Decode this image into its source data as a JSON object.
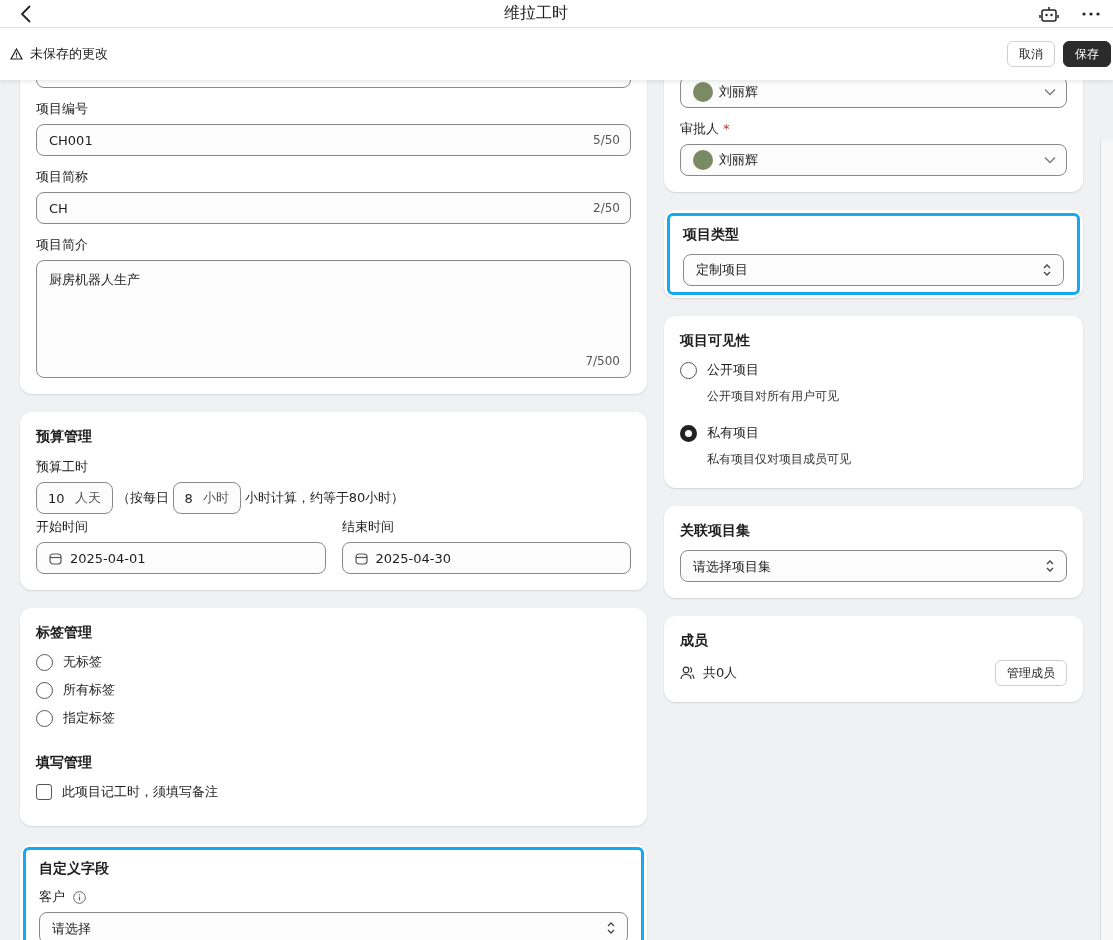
{
  "topbar": {
    "title": "维拉工时"
  },
  "notice": {
    "text": "未保存的更改"
  },
  "actions": [
    {
      "label": "取消",
      "kind": "secondary"
    },
    {
      "label": "保存",
      "kind": "primary"
    }
  ],
  "basic_info": {
    "fields": [
      {
        "kind": "input"
      },
      {
        "kind": "input",
        "label": "项目编号",
        "value": "CH001",
        "count": "5/50"
      },
      {
        "kind": "input",
        "label": "项目简称",
        "value": "CH",
        "count": "2/50"
      },
      {
        "kind": "textarea",
        "label": "项目简介",
        "value": "厨房机器人生产",
        "count": "7/500"
      }
    ]
  },
  "budget": {
    "title": "预算管理",
    "hours_label": "预算工时",
    "days_value": "10",
    "days_unit": "人天",
    "text_before": "（按每日",
    "hours_value": "8",
    "hours_unit": "小时",
    "text_after": "小时计算，约等于80小时）",
    "start_label": "开始时间",
    "start_value": "2025-04-01",
    "end_label": "结束时间",
    "end_value": "2025-04-30"
  },
  "tags": {
    "title": "标签管理",
    "options": [
      {
        "label": "无标签",
        "selected": false
      },
      {
        "label": "所有标签",
        "selected": false
      },
      {
        "label": "指定标签",
        "selected": false
      }
    ]
  },
  "fill": {
    "title": "填写管理",
    "checkbox": {
      "label": "此项目记工时，须填写备注",
      "checked": false
    }
  },
  "custom_fields": {
    "title": "自定义字段",
    "highlighted": true,
    "field_label": "客户",
    "placeholder": "请选择"
  },
  "people": [
    {
      "value": "刘丽辉"
    },
    {
      "label": "审批人",
      "required_mark": "*",
      "value": "刘丽辉"
    }
  ],
  "project_type": {
    "title": "项目类型",
    "highlighted": true,
    "value": "定制项目"
  },
  "visibility": {
    "title": "项目可见性",
    "options": [
      {
        "label": "公开项目",
        "description": "公开项目对所有用户可见",
        "selected": false
      },
      {
        "label": "私有项目",
        "description": "私有项目仅对项目成员可见",
        "selected": true
      }
    ]
  },
  "collection": {
    "title": "关联项目集",
    "placeholder": "请选择项目集"
  },
  "members": {
    "title": "成员",
    "count": "共0人",
    "button": "管理成员"
  }
}
